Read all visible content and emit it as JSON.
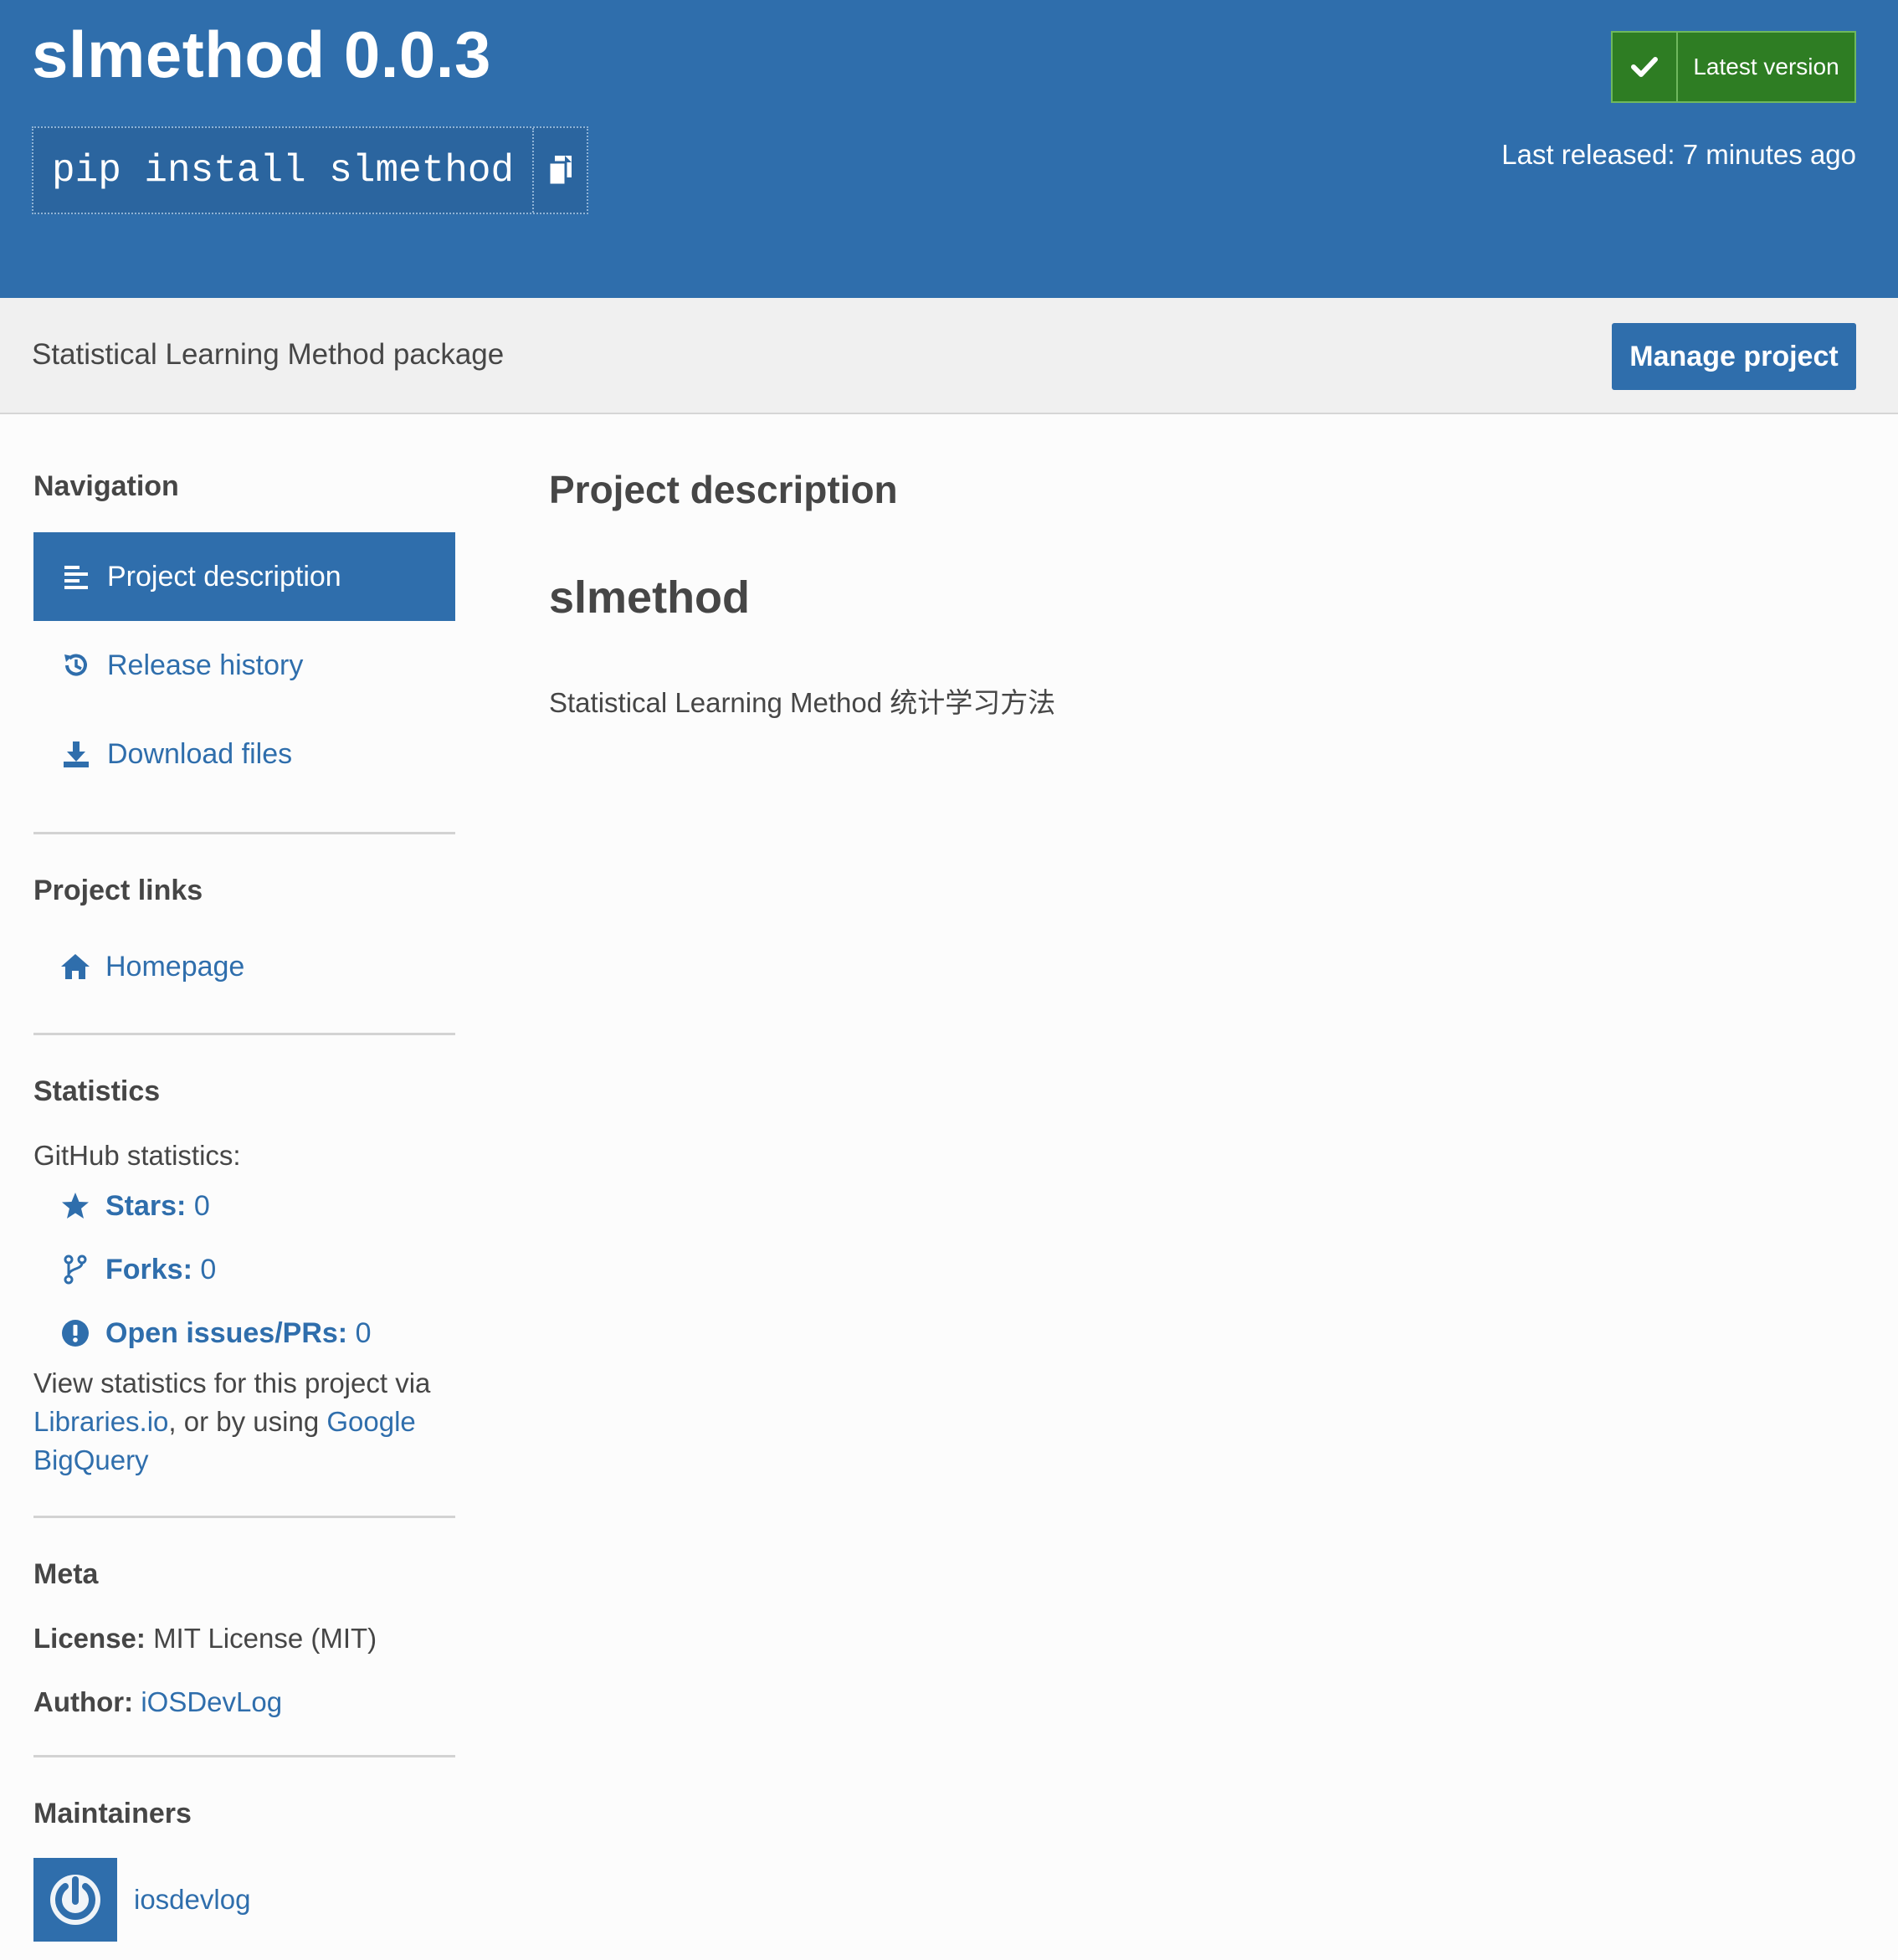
{
  "header": {
    "title": "slmethod 0.0.3",
    "pip_command": "pip install slmethod",
    "latest_label": "Latest version",
    "last_released": "Last released: 7 minutes ago"
  },
  "subheader": {
    "summary": "Statistical Learning Method package",
    "manage_label": "Manage project"
  },
  "sidebar": {
    "navigation_title": "Navigation",
    "nav": [
      {
        "label": "Project description",
        "icon": "align-left-icon"
      },
      {
        "label": "Release history",
        "icon": "history-icon"
      },
      {
        "label": "Download files",
        "icon": "download-icon"
      }
    ],
    "links_title": "Project links",
    "homepage_label": "Homepage",
    "statistics_title": "Statistics",
    "github_label": "GitHub statistics:",
    "stars_label": "Stars:",
    "stars_value": "0",
    "forks_label": "Forks:",
    "forks_value": "0",
    "issues_label": "Open issues/PRs:",
    "issues_value": "0",
    "view_stats_prefix": "View statistics for this project via",
    "libraries_link": "Libraries.io",
    "view_stats_middle": ", or by using",
    "google_link": "Google",
    "bigquery_link": "BigQuery",
    "meta_title": "Meta",
    "license_label": "License:",
    "license_value": "MIT License (MIT)",
    "author_label": "Author:",
    "author_value": "iOSDevLog",
    "maintainers_title": "Maintainers",
    "maintainer_name": "iosdevlog"
  },
  "main": {
    "section_heading": "Project description",
    "readme_title": "slmethod",
    "readme_text": "Statistical Learning Method 统计学习方法"
  },
  "colors": {
    "brand_blue": "#2f6eac",
    "success_green": "#2e7d23",
    "text": "#464646"
  }
}
